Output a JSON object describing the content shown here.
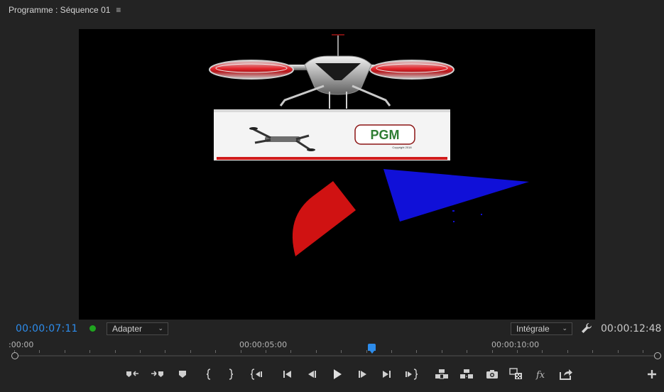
{
  "panel": {
    "title": "Programme : Séquence 01",
    "menu_glyph": "≡"
  },
  "viewer": {
    "logo_text": "PGM",
    "copyright_text": "Copyright 2018",
    "colors": {
      "background": "#000000",
      "red_shape": "#d01212",
      "blue_shape": "#1010d8",
      "banner": "#f4f4f4",
      "banner_stripe": "#d11c1c",
      "rotor_ring": "#e3242b"
    }
  },
  "controls": {
    "current_timecode": "00:00:07:11",
    "status_color": "#1fa51f",
    "zoom_dropdown": "Adapter",
    "quality_dropdown": "Intégrale",
    "duration_timecode": "00:00:12:48",
    "accent_color": "#2d8ceb"
  },
  "ruler": {
    "labels": [
      ":00:00",
      "00:00:05:00",
      "00:00:10:00"
    ]
  },
  "transport": {
    "buttons": [
      "mark-in-icon",
      "mark-out-icon",
      "add-marker-icon",
      "clear-in-icon",
      "clear-out-icon",
      "go-to-in-icon",
      "step-back-icon",
      "step-back-frame-icon",
      "play-icon",
      "step-forward-frame-icon",
      "go-to-out-icon",
      "step-forward-icon",
      "lift-icon",
      "extract-icon",
      "export-frame-icon",
      "comparison-view-icon",
      "fx-icon",
      "export-icon",
      "add-button-icon"
    ]
  }
}
